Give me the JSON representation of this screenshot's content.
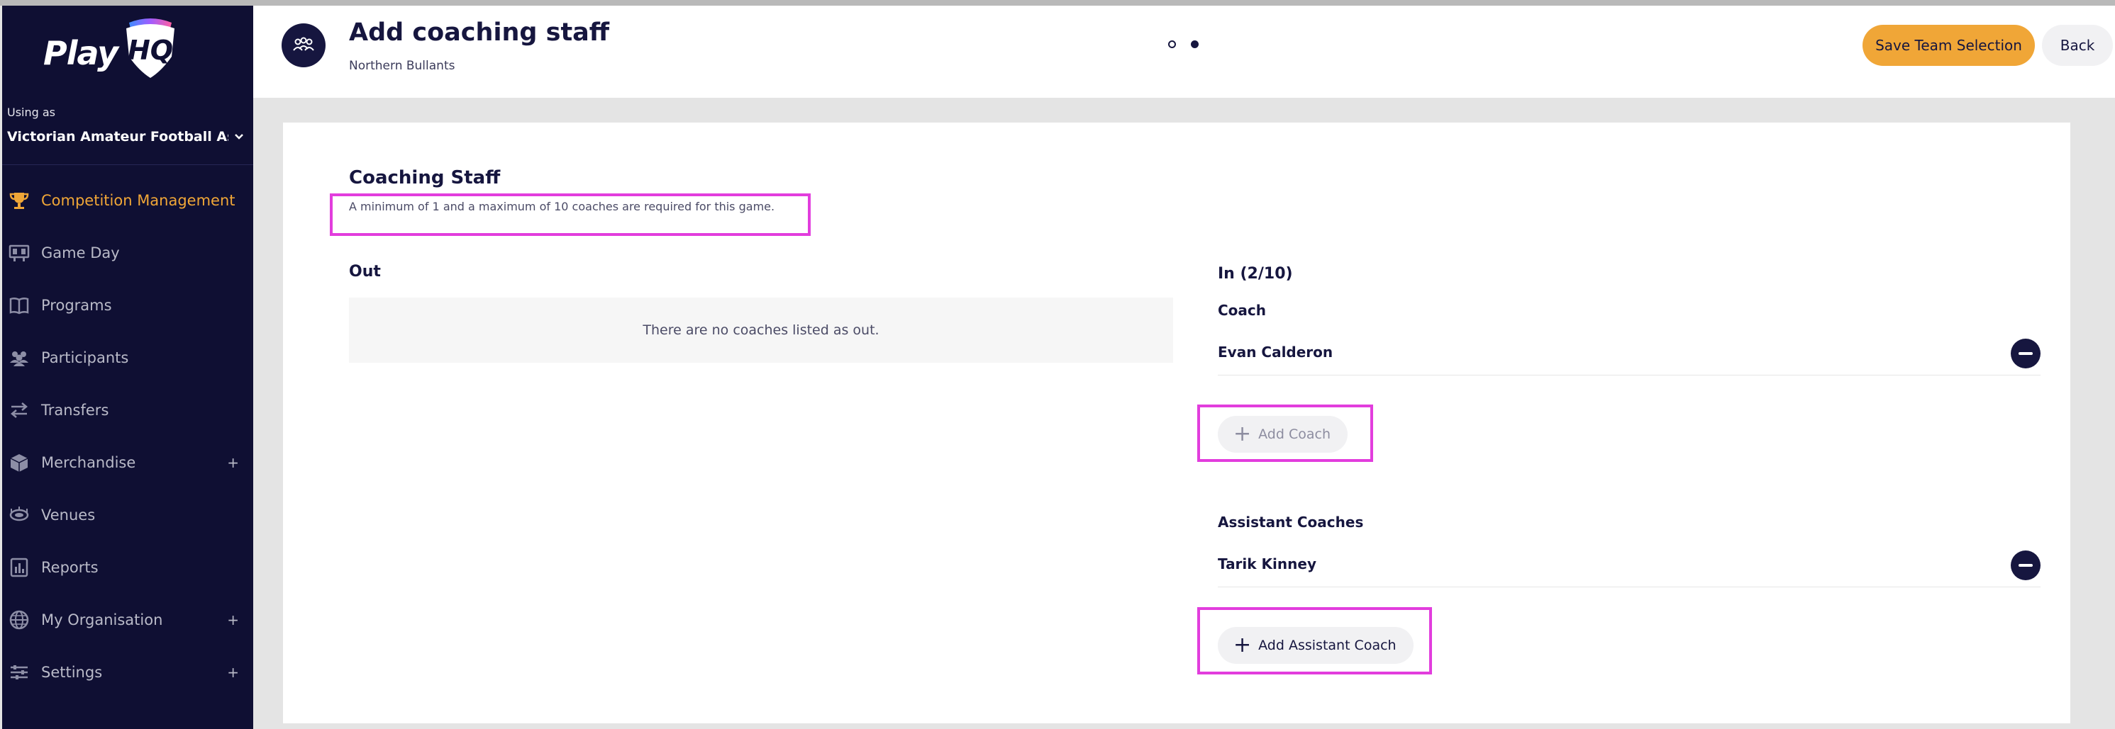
{
  "app": {
    "logo_text": "PlayHQ",
    "logo_play": "Play",
    "logo_hq": "HQ"
  },
  "sidebar": {
    "using_as_label": "Using as",
    "organisation": "Victorian Amateur Football Association",
    "items": [
      {
        "label": "Competition Management",
        "icon": "trophy-icon",
        "active": true
      },
      {
        "label": "Game Day",
        "icon": "scoreboard-icon"
      },
      {
        "label": "Programs",
        "icon": "book-icon"
      },
      {
        "label": "Participants",
        "icon": "people-icon"
      },
      {
        "label": "Transfers",
        "icon": "transfer-arrows-icon"
      },
      {
        "label": "Merchandise",
        "icon": "box-icon",
        "expand": "+"
      },
      {
        "label": "Venues",
        "icon": "stadium-icon"
      },
      {
        "label": "Reports",
        "icon": "report-icon"
      },
      {
        "label": "My Organisation",
        "icon": "globe-icon",
        "expand": "+"
      },
      {
        "label": "Settings",
        "icon": "sliders-icon",
        "expand": "+"
      }
    ]
  },
  "header": {
    "icon": "coaches-icon",
    "title": "Add coaching staff",
    "subtitle": "Northern Bullants",
    "steps_total": 2,
    "step_current": 2,
    "save_label": "Save Team Selection",
    "back_label": "Back"
  },
  "main": {
    "section_title": "Coaching Staff",
    "description": "A minimum of 1 and a maximum of 10 coaches are required for this game.",
    "out": {
      "title": "Out",
      "empty_text": "There are no coaches listed as out."
    },
    "in": {
      "title": "In (2/10)",
      "coach_group": {
        "title": "Coach",
        "people": [
          "Evan Calderon"
        ],
        "add_label": "Add Coach",
        "add_enabled": false
      },
      "assistant_group": {
        "title": "Assistant Coaches",
        "people": [
          "Tarik Kinney"
        ],
        "add_label": "Add Assistant Coach",
        "add_enabled": true
      }
    }
  },
  "colors": {
    "sidebar_bg": "#0f0f33",
    "accent": "#f0a637",
    "highlight": "#e23ddd",
    "navy": "#16163f"
  }
}
